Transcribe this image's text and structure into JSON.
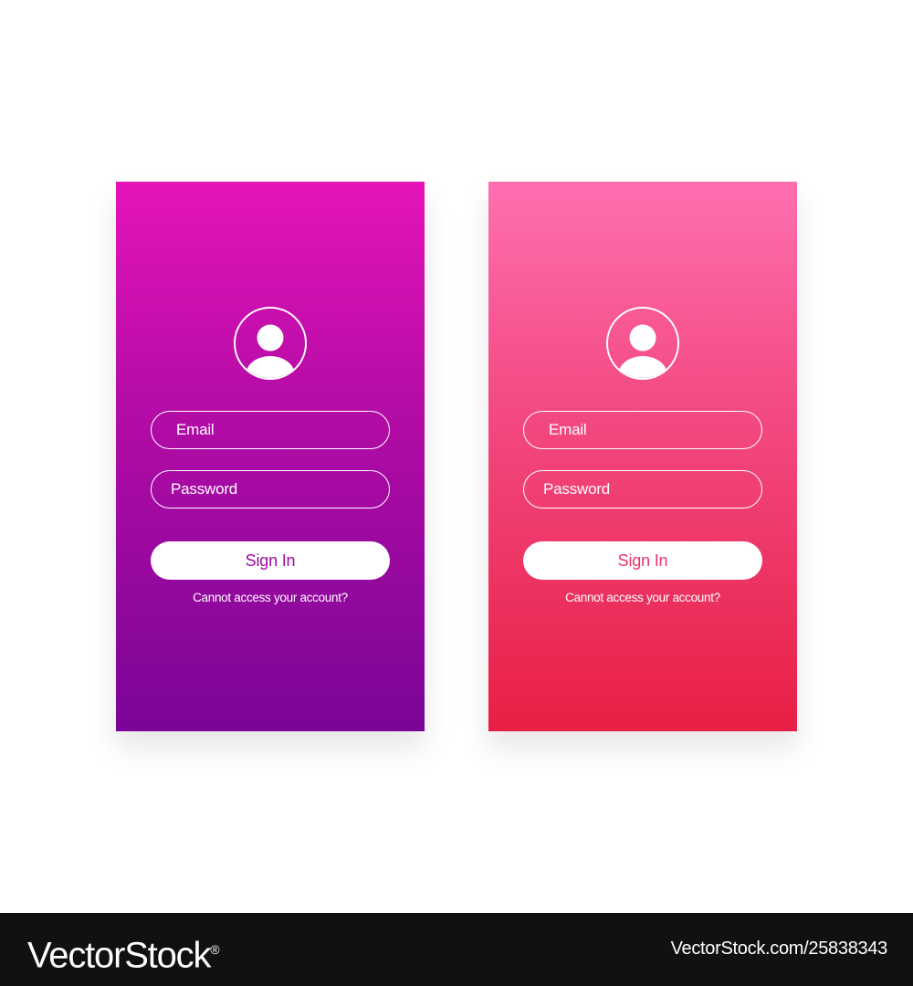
{
  "screens": [
    {
      "theme": "purple",
      "gradient": [
        "#e514b8",
        "#7a0597"
      ],
      "avatar_icon": "user-avatar-icon",
      "email_placeholder": "Email",
      "password_placeholder": "Password",
      "signin_label": "Sign In",
      "forgot_label": "Cannot access your account?"
    },
    {
      "theme": "pink",
      "gradient": [
        "#ff6fb0",
        "#e81f45"
      ],
      "avatar_icon": "user-avatar-icon",
      "email_placeholder": "Email",
      "password_placeholder": "Password",
      "signin_label": "Sign In",
      "forgot_label": "Cannot access your account?"
    }
  ],
  "footer": {
    "brand": "VectorStock",
    "brand_mark": "®",
    "image_id": "VectorStock.com/25838343"
  }
}
